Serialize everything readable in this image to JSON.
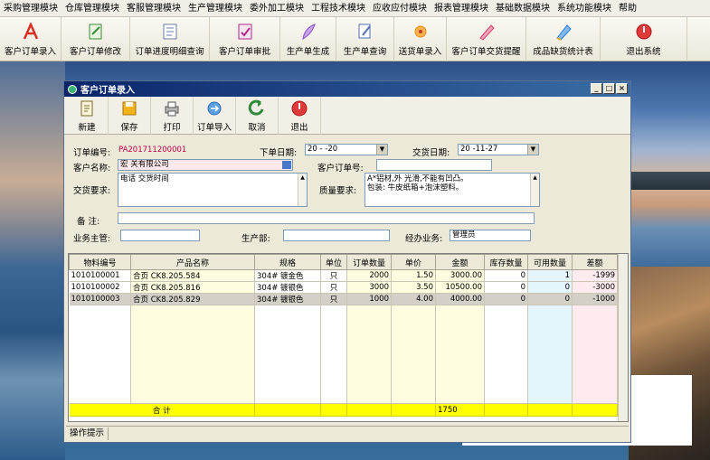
{
  "menu": [
    "采购管理模块",
    "仓库管理模块",
    "客服管理模块",
    "生产管理模块",
    "委外加工模块",
    "工程技术模块",
    "应收应付模块",
    "报表管理模块",
    "基础数据模块",
    "系统功能模块",
    "帮助"
  ],
  "toolbar": [
    {
      "label": "客户订单录入",
      "icon": "pdf-icon",
      "color": "#d93025"
    },
    {
      "label": "客户订单修改",
      "icon": "edit-doc-icon",
      "color": "#3b8c3a"
    },
    {
      "label": "订单进度明细查询",
      "icon": "doc-list-icon",
      "color": "#6a7fa8"
    },
    {
      "label": "客户订单审批",
      "icon": "approve-icon",
      "color": "#b02a8a"
    },
    {
      "label": "生产单生成",
      "icon": "feather-icon",
      "color": "#8a4fc7"
    },
    {
      "label": "生产单查询",
      "icon": "doc-search-icon",
      "color": "#4f6fb0"
    },
    {
      "label": "送货单录入",
      "icon": "flower-icon",
      "color": "#e88a1a"
    },
    {
      "label": "客户订单交货提醒",
      "icon": "pen-icon",
      "color": "#d23d6b"
    },
    {
      "label": "成品缺货统计表",
      "icon": "colorpen-icon",
      "color": "#2a7bd0"
    },
    {
      "label": "退出系统",
      "icon": "exit-icon",
      "color": "#d92b2b"
    }
  ],
  "window": {
    "title": "客户订单录入",
    "tools": [
      {
        "label": "新建",
        "icon": "new-doc-icon"
      },
      {
        "label": "保存",
        "icon": "save-icon"
      },
      {
        "label": "打印",
        "icon": "print-icon"
      },
      {
        "label": "订单导入",
        "icon": "import-icon"
      },
      {
        "label": "取消",
        "icon": "cancel-icon"
      },
      {
        "label": "退出",
        "icon": "exit-icon"
      }
    ]
  },
  "form": {
    "order_no_label": "订单编号:",
    "order_no": "PA201711200001",
    "order_date_label": "下单日期:",
    "order_date": "20   -  -20",
    "delivery_date_label": "交货日期:",
    "delivery_date": "20 -11-27",
    "customer_label": "客户名称:",
    "customer": "宏      关有限公司",
    "customer_order_label": "客户订单号:",
    "customer_order": "",
    "delivery_req_label": "交货要求:",
    "delivery_req": "电话         交货时间",
    "quality_req_label": "质量要求:",
    "quality_req_line1": "A*铝材,外    光滑,不能有凹凸。",
    "quality_req_line2": "包装: 牛皮纸箱+泡沫塑料。",
    "remark_label": "备  注:",
    "remark": "",
    "supervisor_label": "业务主管:",
    "supervisor": "",
    "production_label": "生产部:",
    "production": "",
    "agent_label": "经办业务:",
    "agent": "管理员"
  },
  "grid": {
    "headers": [
      "物料编号",
      "产品名称",
      "规格",
      "单位",
      "订单数量",
      "单价",
      "金额",
      "库存数量",
      "可用数量",
      "差额"
    ],
    "rows": [
      [
        "1010100001",
        "合页 CK8.205.584",
        "304# 镀金色",
        "只",
        "2000",
        "1.50",
        "3000.00",
        "0",
        "1",
        "-1999"
      ],
      [
        "1010100002",
        "合页 CK8.205.816",
        "304# 镀银色",
        "只",
        "3000",
        "3.50",
        "10500.00",
        "0",
        "0",
        "-3000"
      ],
      [
        "1010100003",
        "合页 CK8.205.829",
        "304# 镀银色",
        "只",
        "1000",
        "4.00",
        "4000.00",
        "0",
        "0",
        "-1000"
      ]
    ],
    "total_label": "合 计",
    "total_amount": "1750"
  },
  "status": {
    "tab": "操作提示"
  }
}
